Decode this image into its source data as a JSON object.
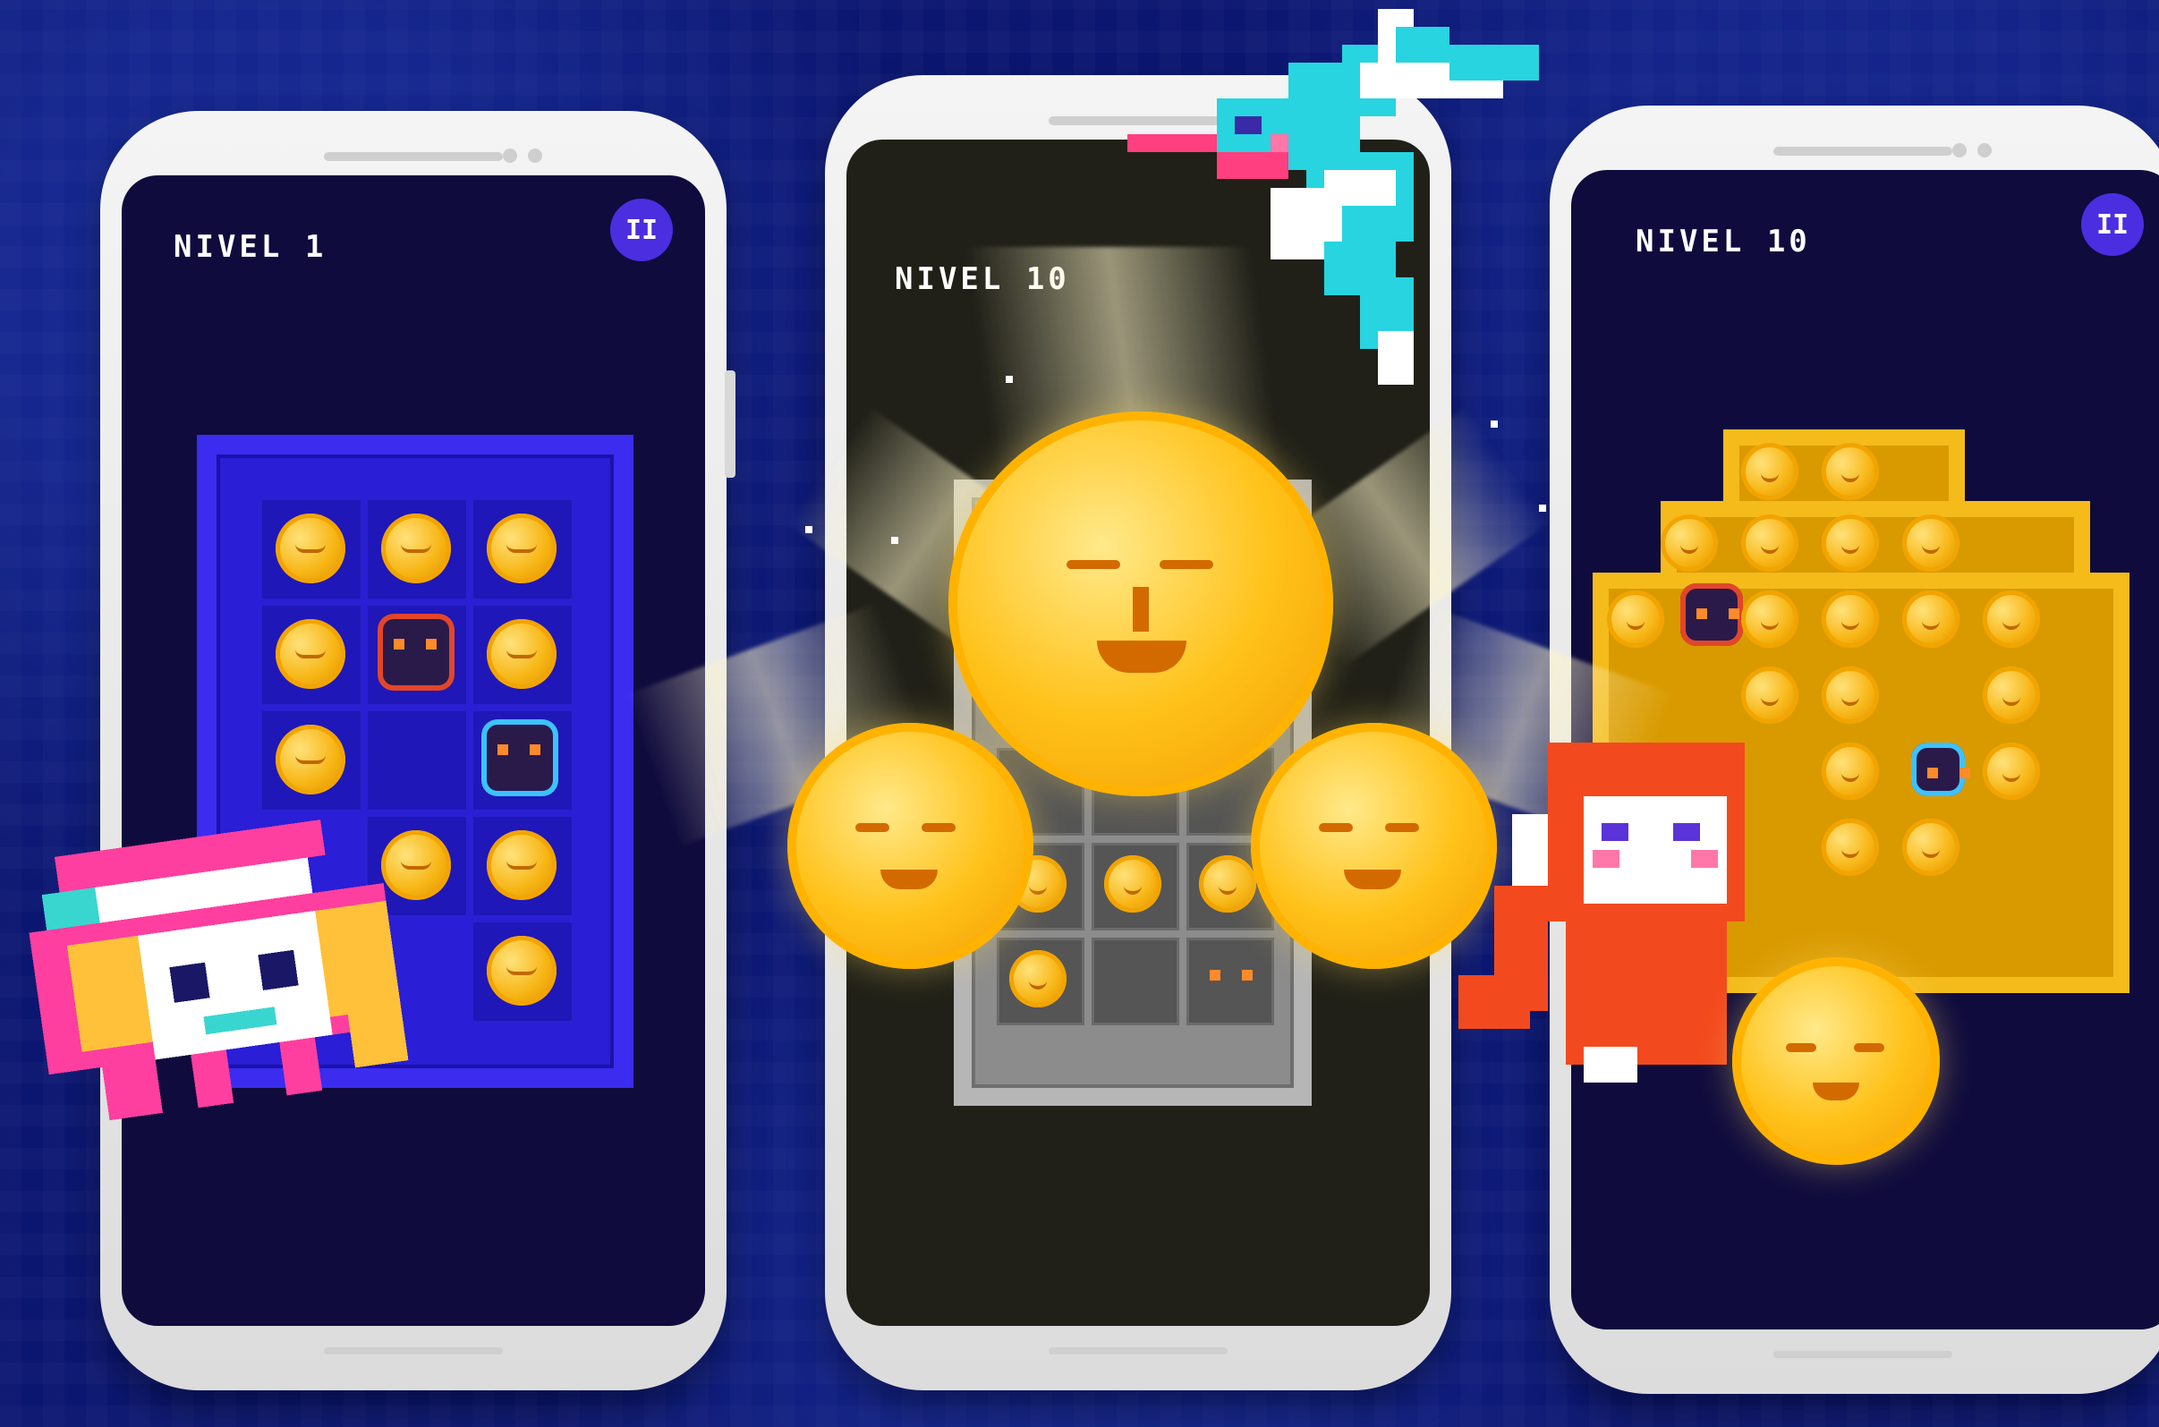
{
  "phones": [
    {
      "level_label": "NIVEL 1",
      "pause_icon": "pause-icon",
      "board_theme": "blue"
    },
    {
      "level_label": "NIVEL 10",
      "board_theme": "gray"
    },
    {
      "level_label": "NIVEL 10",
      "pause_icon": "pause-icon",
      "board_theme": "gold"
    }
  ],
  "pause_glyph": "II",
  "colors": {
    "background": "#0b1670",
    "screen": "#0d0b3a",
    "pause_button": "#4a2ee0",
    "coin": "#f7b514",
    "blue_board": "#2a1ed6",
    "gold_board": "#d99a00",
    "gray_board": "#8c8c8c"
  },
  "characters": [
    "hummingbird",
    "monkey",
    "pink-lion-mask",
    "sun"
  ]
}
